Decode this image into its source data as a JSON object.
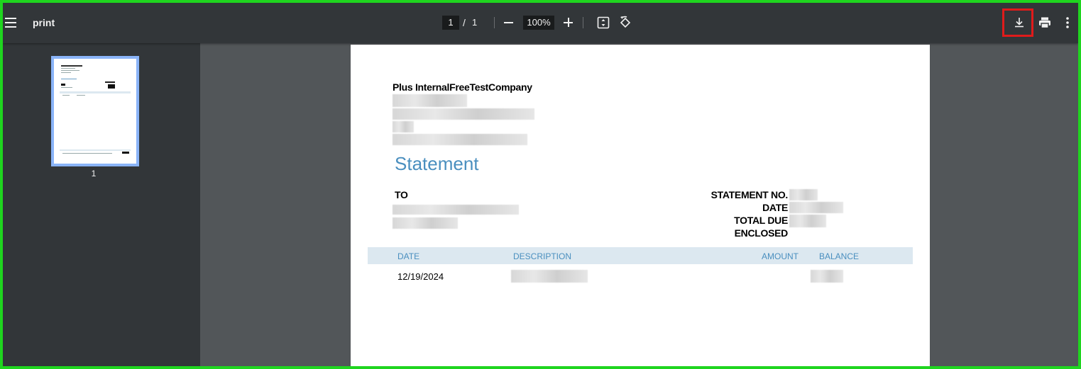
{
  "toolbar": {
    "title": "print",
    "page_current": "1",
    "page_separator": "/",
    "page_total": "1",
    "zoom": "100%"
  },
  "sidebar": {
    "thumbnail_label": "1"
  },
  "document": {
    "company": "Plus InternalFreeTestCompany",
    "title": "Statement",
    "to_label": "TO",
    "right_labels": [
      "STATEMENT NO.",
      "DATE",
      "TOTAL DUE",
      "ENCLOSED"
    ],
    "table_headers": [
      "DATE",
      "DESCRIPTION",
      "AMOUNT",
      "BALANCE"
    ],
    "rows": [
      {
        "date": "12/19/2024"
      }
    ],
    "accent_color": "#4a8fbf"
  }
}
